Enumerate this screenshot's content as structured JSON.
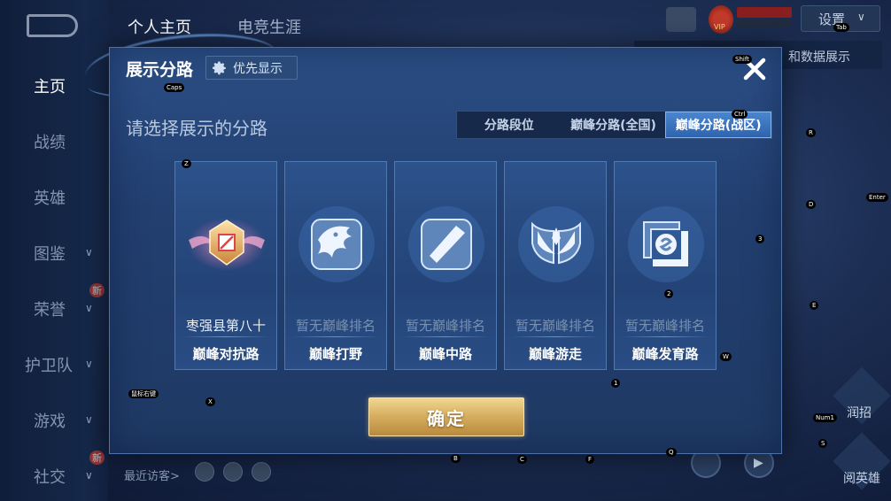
{
  "background": {
    "sidebar": [
      {
        "label": "主页",
        "active": true,
        "has_chevron": false
      },
      {
        "label": "战绩",
        "active": false,
        "has_chevron": false
      },
      {
        "label": "英雄",
        "active": false,
        "has_chevron": false
      },
      {
        "label": "图鉴",
        "active": false,
        "has_chevron": true
      },
      {
        "label": "荣誉",
        "active": false,
        "has_chevron": true,
        "badge": "新"
      },
      {
        "label": "护卫队",
        "active": false,
        "has_chevron": true
      },
      {
        "label": "游戏",
        "active": false,
        "has_chevron": true
      },
      {
        "label": "社交",
        "active": false,
        "has_chevron": true,
        "badge": "新"
      }
    ],
    "top_tabs": [
      {
        "label": "个人主页",
        "active": true
      },
      {
        "label": "电竞生涯",
        "active": false
      }
    ],
    "vip_label": "VIP",
    "settings_label": "设置",
    "data_display_label": "和数据展示",
    "recent_visitors_label": "最近访客>",
    "right_labels": [
      "润招",
      "阅英雄"
    ]
  },
  "modal": {
    "title": "展示分路",
    "priority_button": "优先显示",
    "subtitle": "请选择展示的分路",
    "tabs": [
      {
        "label": "分路段位",
        "active": false
      },
      {
        "label": "巅峰分路(全国)",
        "active": false
      },
      {
        "label": "巅峰分路(战区)",
        "active": true
      }
    ],
    "cards": [
      {
        "rank": "枣强县第八十",
        "lane": "巅峰对抗路",
        "emblem": "clash-lane-emblem-icon",
        "ranked": true
      },
      {
        "rank": "暂无巅峰排名",
        "lane": "巅峰打野",
        "emblem": "jungle-dragon-icon",
        "ranked": false
      },
      {
        "rank": "暂无巅峰排名",
        "lane": "巅峰中路",
        "emblem": "mid-lane-icon",
        "ranked": false
      },
      {
        "rank": "暂无巅峰排名",
        "lane": "巅峰游走",
        "emblem": "roam-wings-icon",
        "ranked": false
      },
      {
        "rank": "暂无巅峰排名",
        "lane": "巅峰发育路",
        "emblem": "farm-lane-icon",
        "ranked": false
      }
    ],
    "confirm_button": "确定"
  },
  "key_hints": [
    "Caps",
    "Tab",
    "Shift",
    "Z",
    "X",
    "R",
    "D",
    "Enter",
    "3",
    "E",
    "2",
    "W",
    "1",
    "Num1",
    "S",
    "B",
    "C",
    "F",
    "Q",
    "Ctrl",
    "鼠标右键"
  ],
  "colors": {
    "accent_blue": "#3a78c8",
    "confirm_gold": "#d8b062",
    "modal_bg": "#223f70"
  }
}
